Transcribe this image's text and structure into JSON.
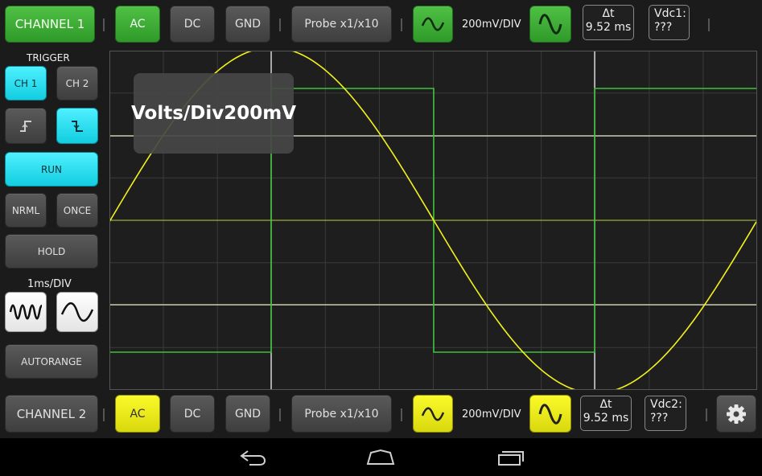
{
  "top_bar": {
    "channel_label": "CHANNEL 1",
    "coupling": [
      "AC",
      "DC",
      "GND"
    ],
    "probe_label": "Probe x1/x10",
    "volts_div": "200mV/DIV",
    "delta_t_label": "Δt",
    "delta_t_value": "9.52 ms",
    "vdc_label": "Vdc1:",
    "vdc_value": "???"
  },
  "bottom_bar": {
    "channel_label": "CHANNEL 2",
    "coupling": [
      "AC",
      "DC",
      "GND"
    ],
    "probe_label": "Probe x1/x10",
    "volts_div": "200mV/DIV",
    "delta_t_label": "Δt",
    "delta_t_value": "9.52 ms",
    "vdc_label": "Vdc2:",
    "vdc_value": "???"
  },
  "left_panel": {
    "trigger_label": "TRIGGER",
    "ch1": "CH 1",
    "ch2": "CH 2",
    "run": "RUN",
    "nrml": "NRML",
    "once": "ONCE",
    "hold": "HOLD",
    "timebase": "1ms/DIV",
    "autorange": "AUTORANGE"
  },
  "toast": {
    "text": "Volts/Div200mV"
  },
  "colors": {
    "ch1": "#3ec23a",
    "ch2": "#f2f21a",
    "accent": "#29e0f2"
  },
  "icons": {
    "trigger_rising": "rising-edge-icon",
    "trigger_falling": "falling-edge-icon",
    "ac_coupling": "sine-wave-icon",
    "settings": "gear-icon"
  }
}
